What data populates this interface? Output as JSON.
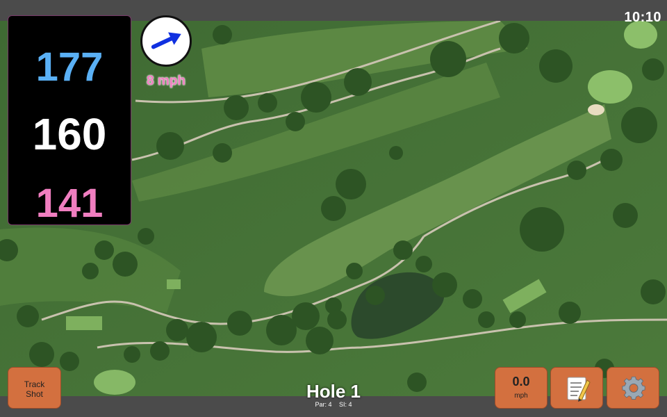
{
  "status": {
    "time": "10:10"
  },
  "distances": {
    "back": "177",
    "middle": "160",
    "front": "141"
  },
  "wind": {
    "speed_label": "8 mph",
    "direction_deg": 65
  },
  "buttons": {
    "track_shot": "Track Shot",
    "speed_value": "0.0",
    "speed_unit": "mph",
    "notes_icon": "memo-icon",
    "settings_icon": "gear-icon"
  },
  "hole": {
    "title": "Hole 1",
    "par_label": "Par: 4",
    "si_label": "SI: 4"
  },
  "colors": {
    "back": "#5ab0f5",
    "middle": "#ffffff",
    "front": "#f07ec0",
    "button": "#d3703f",
    "bar": "#4b4b4b"
  }
}
